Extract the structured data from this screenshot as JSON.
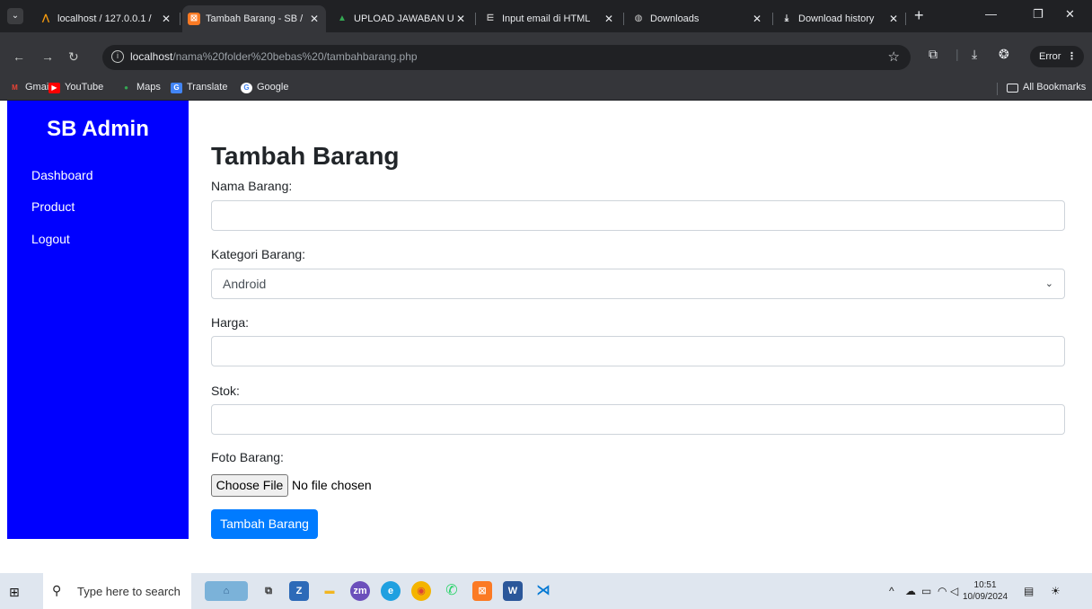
{
  "browser": {
    "tabs": [
      {
        "title": "localhost / 127.0.0.1 /",
        "icon": "phpmyadmin-icon"
      },
      {
        "title": "Tambah Barang - SB /",
        "icon": "xampp-icon",
        "active": true
      },
      {
        "title": "UPLOAD JAWABAN U",
        "icon": "google-drive-icon"
      },
      {
        "title": "Input email di HTML",
        "icon": "stackoverflow-icon"
      },
      {
        "title": "Downloads",
        "icon": "globe-icon"
      },
      {
        "title": "Download history",
        "icon": "download-icon"
      }
    ],
    "url_host": "localhost",
    "url_path": "/nama%20folder%20bebas%20/tambahbarang.php",
    "profile_label": "Error",
    "bookmarks": [
      "Gmail",
      "YouTube",
      "Maps",
      "Translate",
      "Google"
    ],
    "all_bookmarks": "All Bookmarks"
  },
  "sidebar": {
    "brand": "SB Admin",
    "items": [
      "Dashboard",
      "Product",
      "Logout"
    ],
    "color": "#0000ff"
  },
  "form": {
    "title": "Tambah Barang",
    "nama_label": "Nama Barang:",
    "nama_value": "",
    "kategori_label": "Kategori Barang:",
    "kategori_selected": "Android",
    "harga_label": "Harga:",
    "harga_value": "",
    "stok_label": "Stok:",
    "stok_value": "",
    "foto_label": "Foto Barang:",
    "file_button": "Choose File",
    "file_status": "No file chosen",
    "submit_label": "Tambah Barang",
    "submit_color": "#007bff"
  },
  "taskbar": {
    "search_placeholder": "Type here to search",
    "time": "10:51",
    "date": "10/09/2024"
  }
}
